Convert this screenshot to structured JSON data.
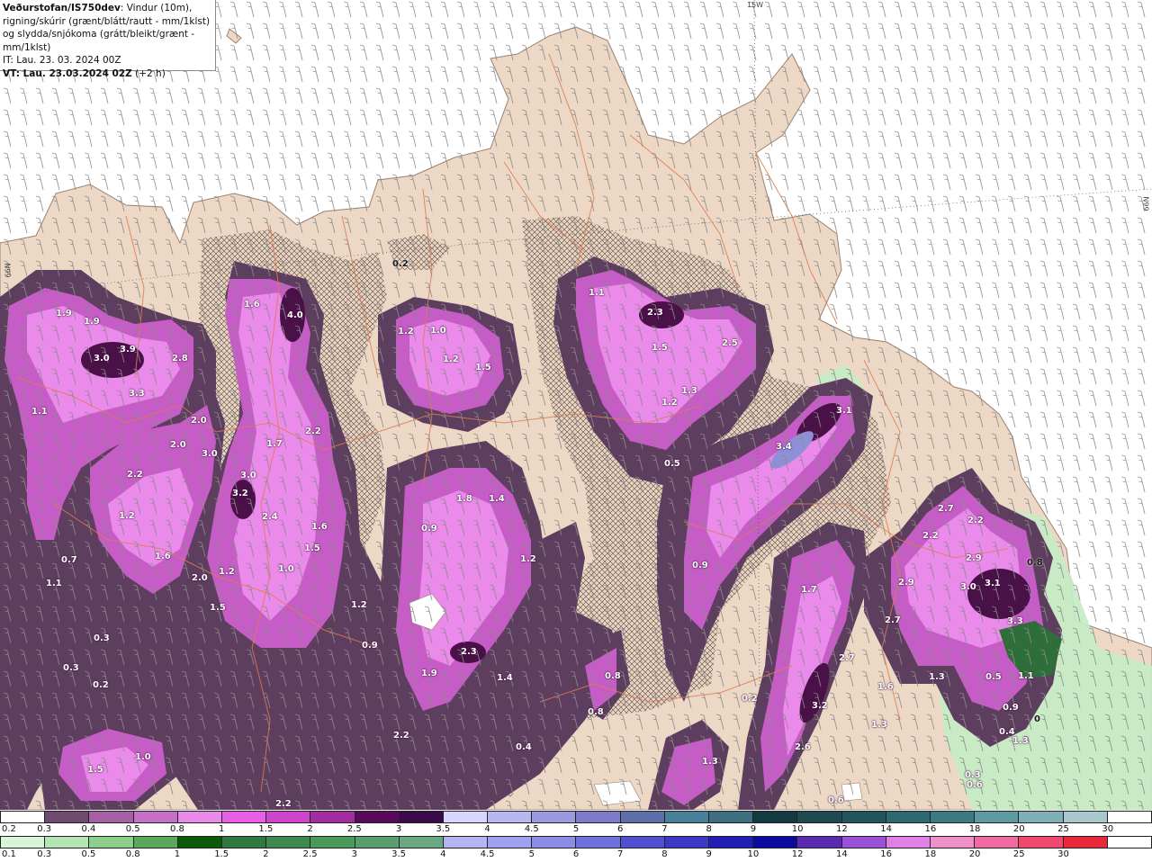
{
  "info": {
    "brand": "Veðurstofan/IS750dev",
    "description_rest": ": Vindur (10m), rigning/skúrir (grænt/blátt/rautt - mm/1klst) og slydda/snjókoma (grátt/bleikt/grænt - mm/1klst)",
    "it": "IT: Lau. 23. 03. 2024 00Z",
    "vt": "VT: Lau. 23.03.2024 02Z",
    "vt_offset": "(+2 h)"
  },
  "coords": {
    "lon_15w": "15W",
    "lat_left": "66N",
    "lat_right": "66N"
  },
  "labels": [
    {
      "t": "0.2"
    },
    {
      "t": "1.9"
    },
    {
      "t": "1.9"
    },
    {
      "t": "3.9"
    },
    {
      "t": "3.0"
    },
    {
      "t": "2.8"
    },
    {
      "t": "3.3"
    },
    {
      "t": "1.1"
    },
    {
      "t": "2.0"
    },
    {
      "t": "2.0"
    },
    {
      "t": "3.0"
    },
    {
      "t": "2.2"
    },
    {
      "t": "1.2"
    },
    {
      "t": "1.6"
    },
    {
      "t": "2.0"
    },
    {
      "t": "1.2"
    },
    {
      "t": "1.5"
    },
    {
      "t": "0.7"
    },
    {
      "t": "1.1"
    },
    {
      "t": "0.3"
    },
    {
      "t": "0.3"
    },
    {
      "t": "0.2"
    },
    {
      "t": "1.5"
    },
    {
      "t": "1.0"
    },
    {
      "t": "1.6"
    },
    {
      "t": "4.0"
    },
    {
      "t": "1.7"
    },
    {
      "t": "2.2"
    },
    {
      "t": "3.0"
    },
    {
      "t": "3.2"
    },
    {
      "t": "2.4"
    },
    {
      "t": "1.6"
    },
    {
      "t": "1.5"
    },
    {
      "t": "1.0"
    },
    {
      "t": "1.2"
    },
    {
      "t": "0.9"
    },
    {
      "t": "2.2"
    },
    {
      "t": "2.2"
    },
    {
      "t": "1.2"
    },
    {
      "t": "1.0"
    },
    {
      "t": "1.2"
    },
    {
      "t": "1.5"
    },
    {
      "t": "1.8"
    },
    {
      "t": "1.4"
    },
    {
      "t": "0.9"
    },
    {
      "t": "1.2"
    },
    {
      "t": "2.3"
    },
    {
      "t": "1.9"
    },
    {
      "t": "1.4"
    },
    {
      "t": "0.4"
    },
    {
      "t": "1.1"
    },
    {
      "t": "2.3"
    },
    {
      "t": "1.5"
    },
    {
      "t": "2.5"
    },
    {
      "t": "1.3"
    },
    {
      "t": "1.2"
    },
    {
      "t": "0.5"
    },
    {
      "t": "0.8"
    },
    {
      "t": "0.8"
    },
    {
      "t": "3.1"
    },
    {
      "t": "3.4"
    },
    {
      "t": "0.9"
    },
    {
      "t": "1.7"
    },
    {
      "t": "0.2"
    },
    {
      "t": "1.3"
    },
    {
      "t": "2.7"
    },
    {
      "t": "3.2"
    },
    {
      "t": "2.6"
    },
    {
      "t": "1.6"
    },
    {
      "t": "1.3"
    },
    {
      "t": "0.6"
    },
    {
      "t": "2.7"
    },
    {
      "t": "2.2"
    },
    {
      "t": "2.2"
    },
    {
      "t": "2.9"
    },
    {
      "t": "2.9"
    },
    {
      "t": "3.0"
    },
    {
      "t": "3.1"
    },
    {
      "t": "0.8"
    },
    {
      "t": "3.3"
    },
    {
      "t": "2.7"
    },
    {
      "t": "1.3"
    },
    {
      "t": "0.5"
    },
    {
      "t": "1.1"
    },
    {
      "t": "0.9"
    },
    {
      "t": "0.4"
    },
    {
      "t": "1.3"
    },
    {
      "t": "0"
    },
    {
      "t": "0.3"
    },
    {
      "t": "0.6"
    }
  ],
  "legend_snow": {
    "labels": [
      "0.2",
      "0.3",
      "0.4",
      "0.5",
      "0.8",
      "1",
      "1.5",
      "2",
      "2.5",
      "3",
      "3.5",
      "4",
      "4.5",
      "5",
      "6",
      "7",
      "8",
      "9",
      "10",
      "12",
      "14",
      "16",
      "18",
      "20",
      "25",
      "30"
    ],
    "colors": [
      "#ffffff",
      "#6e4b6e",
      "#a55fa5",
      "#c670c6",
      "#e88ae8",
      "#e65fe6",
      "#cc44cc",
      "#a02ea0",
      "#5a0a5a",
      "#3a0a4a",
      "#d6d6ff",
      "#b8b8f0",
      "#9a9ae0",
      "#7c7cc8",
      "#5e6ea8",
      "#4a7f9a",
      "#3e6e80",
      "#123a40",
      "#1e4a50",
      "#24555c",
      "#2e6870",
      "#3a7b82",
      "#5f9aa0",
      "#7eb0b6",
      "#a8c8cc",
      "#ffffff"
    ]
  },
  "legend_rain": {
    "labels": [
      "0.1",
      "0.3",
      "0.5",
      "0.8",
      "1",
      "1.5",
      "2",
      "2.5",
      "3",
      "3.5",
      "4",
      "4.5",
      "5",
      "6",
      "7",
      "8",
      "9",
      "10",
      "12",
      "14",
      "16",
      "18",
      "20",
      "25",
      "30"
    ],
    "colors": [
      "#d8f5d8",
      "#b4e6b4",
      "#8ccf8c",
      "#5aa85a",
      "#0a5a0a",
      "#2e7a3e",
      "#3e8a4e",
      "#4a9a5a",
      "#5a9e6e",
      "#6aa882",
      "#b4b4f0",
      "#a0a0f0",
      "#8c8ce6",
      "#7070dc",
      "#5050d0",
      "#3a3ac4",
      "#2020b4",
      "#0a0aa0",
      "#5a2ab0",
      "#9a50d8",
      "#e080e6",
      "#f090c8",
      "#f06aa0",
      "#f04a6e",
      "#e8283a",
      "#ffffff"
    ]
  }
}
